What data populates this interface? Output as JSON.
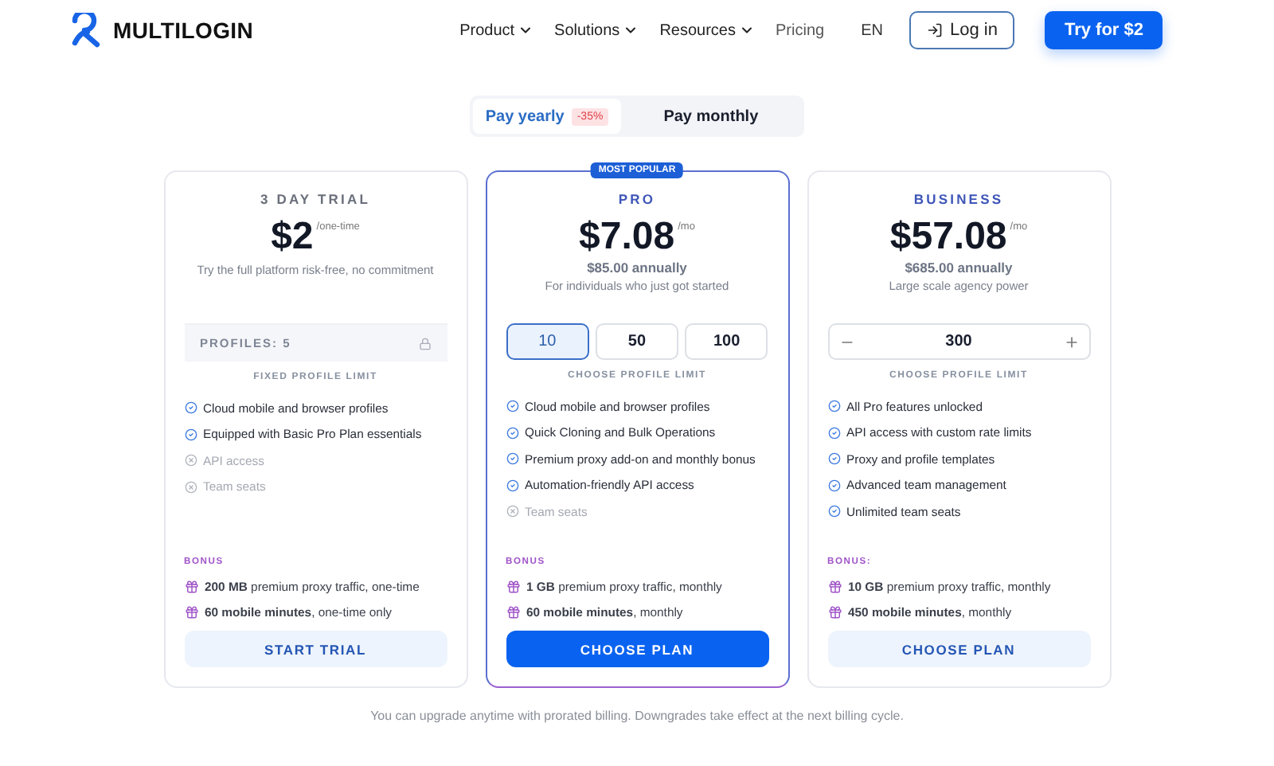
{
  "header": {
    "logo": "MULTILOGIN",
    "nav": [
      {
        "label": "Product",
        "dropdown": true
      },
      {
        "label": "Solutions",
        "dropdown": true
      },
      {
        "label": "Resources",
        "dropdown": true
      },
      {
        "label": "Pricing",
        "dropdown": false
      }
    ],
    "language": "EN",
    "login": "Log in",
    "cta": "Try for $2"
  },
  "billing_toggle": [
    {
      "label": "Pay yearly",
      "badge": "-35%",
      "selected": true
    },
    {
      "label": "Pay monthly",
      "selected": false
    }
  ],
  "plans": [
    {
      "title": "3 DAY TRIAL",
      "featured": false,
      "price": "$2",
      "period": "/one-time",
      "tagline": "Try the full platform risk-free, no commitment",
      "limit": {
        "kind": "locked",
        "label": "PROFILES: 5"
      },
      "limit_caption": "FIXED PROFILE LIMIT",
      "features": [
        {
          "text": "Cloud mobile and browser profiles",
          "included": true
        },
        {
          "text": "Equipped with Basic Pro Plan essentials",
          "included": true
        },
        {
          "text": "API access",
          "included": false
        },
        {
          "text": "Team seats",
          "included": false
        }
      ],
      "bonus_label": "BONUS",
      "bonus": [
        "**200 MB** premium proxy traffic, one-time",
        "**60 mobile minutes**, one-time only"
      ],
      "button": "START TRIAL"
    },
    {
      "title": "PRO",
      "featured": true,
      "badge": "MOST POPULAR",
      "price": "$7.08",
      "period": "/mo",
      "annual": "$85.00 annually",
      "tagline": "For individuals who just got started",
      "limit": {
        "kind": "options",
        "options": [
          {
            "label": "10",
            "selected": true
          },
          {
            "label": "50",
            "selected": false
          },
          {
            "label": "100",
            "selected": false
          }
        ]
      },
      "limit_caption": "CHOOSE PROFILE LIMIT",
      "features": [
        {
          "text": "Cloud mobile and browser profiles",
          "included": true
        },
        {
          "text": "Quick Cloning and Bulk Operations",
          "included": true
        },
        {
          "text": "Premium proxy add-on and monthly bonus",
          "included": true
        },
        {
          "text": "Automation-friendly API access",
          "included": true
        },
        {
          "text": "Team seats",
          "included": false
        }
      ],
      "bonus_label": "BONUS",
      "bonus": [
        "**1 GB** premium proxy traffic, monthly",
        "**60 mobile minutes**, monthly"
      ],
      "button": "CHOOSE PLAN"
    },
    {
      "title": "BUSINESS",
      "featured": false,
      "price": "$57.08",
      "period": "/mo",
      "annual": "$685.00 annually",
      "tagline": "Large scale agency power",
      "limit": {
        "kind": "stepper",
        "value": "300"
      },
      "limit_caption": "CHOOSE PROFILE LIMIT",
      "features": [
        {
          "text": "All Pro features unlocked",
          "included": true
        },
        {
          "text": "API access with custom rate limits",
          "included": true
        },
        {
          "text": "Proxy and profile templates",
          "included": true
        },
        {
          "text": "Advanced team management",
          "included": true
        },
        {
          "text": "Unlimited team seats",
          "included": true
        }
      ],
      "bonus_label": "BONUS:",
      "bonus": [
        "**10 GB** premium proxy traffic, monthly",
        "**450 mobile minutes**, monthly"
      ],
      "button": "CHOOSE PLAN"
    }
  ],
  "footnote": "You can upgrade anytime with prorated billing. Downgrades take effect at the next billing cycle."
}
